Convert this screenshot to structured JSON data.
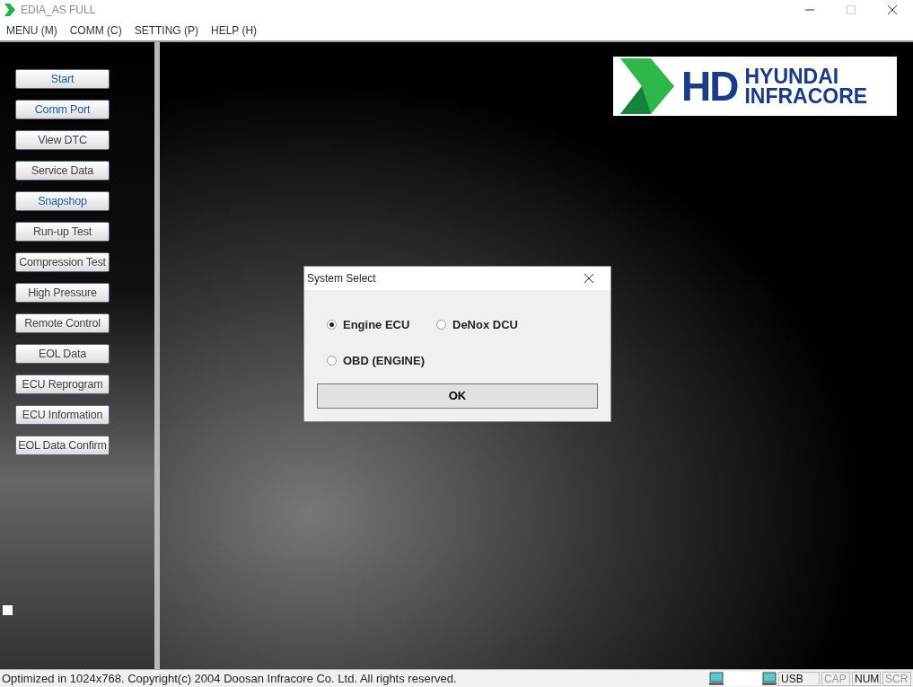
{
  "window": {
    "title": "EDIA_AS FULL"
  },
  "menu": [
    {
      "label": "MENU (M)"
    },
    {
      "label": "COMM (C)"
    },
    {
      "label": "SETTING (P)"
    },
    {
      "label": "HELP (H)"
    }
  ],
  "sidebar": {
    "items": [
      {
        "label": "Start",
        "color": "#1f5ea8"
      },
      {
        "label": "Comm Port",
        "color": "#1f5ea8"
      },
      {
        "label": "View DTC",
        "color": "#444444"
      },
      {
        "label": "Service Data",
        "color": "#444444"
      },
      {
        "label": "Snapshop",
        "color": "#1f5ea8"
      },
      {
        "label": "Run-up Test",
        "color": "#444444"
      },
      {
        "label": "Compression Test",
        "color": "#444444"
      },
      {
        "label": "High Pressure",
        "color": "#444444"
      },
      {
        "label": "Remote Control",
        "color": "#444444"
      },
      {
        "label": "EOL Data",
        "color": "#444444"
      },
      {
        "label": "ECU Reprogram",
        "color": "#444444"
      },
      {
        "label": "ECU Information",
        "color": "#444444"
      },
      {
        "label": "EOL Data Confirm",
        "color": "#444444"
      }
    ]
  },
  "logo": {
    "mark": "HD",
    "line_1": "HYUNDAI",
    "line_2": "INFRACORE"
  },
  "dialog": {
    "title": "System Select",
    "options": [
      {
        "label": "Engine ECU",
        "selected": true
      },
      {
        "label": "DeNox DCU",
        "selected": false
      },
      {
        "label": "OBD (ENGINE)",
        "selected": false
      }
    ],
    "button": "OK"
  },
  "status_bar": {
    "text": "Optimized in 1024x768. Copyright(c) 2004 Doosan Infracore Co. Ltd. All rights reserved.",
    "indicators": [
      {
        "label": "USB",
        "disabled": false
      },
      {
        "label": "CAP",
        "disabled": true
      },
      {
        "label": "NUM",
        "disabled": false
      },
      {
        "label": "SCR",
        "disabled": true
      }
    ]
  }
}
